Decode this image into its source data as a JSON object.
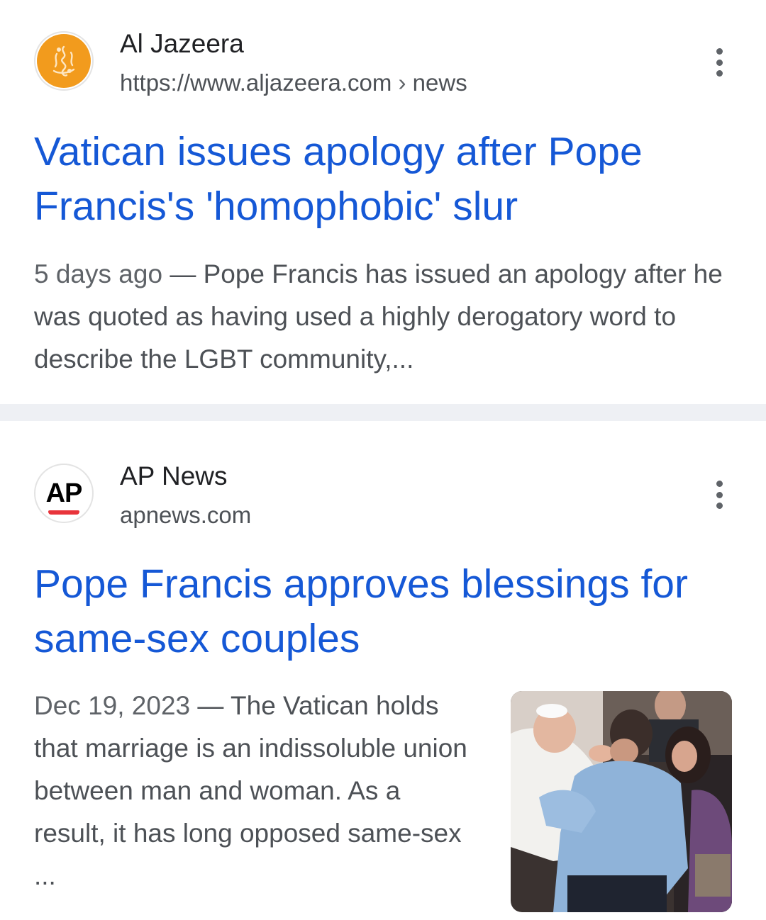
{
  "results": [
    {
      "source_name": "Al Jazeera",
      "url_base": "https://www.aljazeera.com",
      "url_separator": "›",
      "url_path": "news",
      "favicon_icon": "aljazeera-logo-icon",
      "title": "Vatican issues apology after Pope Francis's 'homophobic' slur",
      "date": "5 days ago",
      "dash": "—",
      "snippet": "Pope Francis has issued an apology after he was quoted as having used a highly derogatory word to describe the LGBT community,..."
    },
    {
      "source_name": "AP News",
      "url_base": "apnews.com",
      "favicon_icon": "ap-logo-icon",
      "favicon_text": "AP",
      "title": "Pope Francis approves blessings for same-sex couples",
      "date": "Dec 19, 2023",
      "dash": "—",
      "snippet": "The Vatican holds that marriage is an indissoluble union between man and woman. As a result, it has long opposed same-sex ...",
      "thumbnail": "pope-blessing-couple-photo"
    }
  ],
  "colors": {
    "title_link": "#1558d6",
    "aljazeera_orange": "#f29b1d",
    "divider": "#eef0f4",
    "text_secondary": "#4d5156"
  }
}
